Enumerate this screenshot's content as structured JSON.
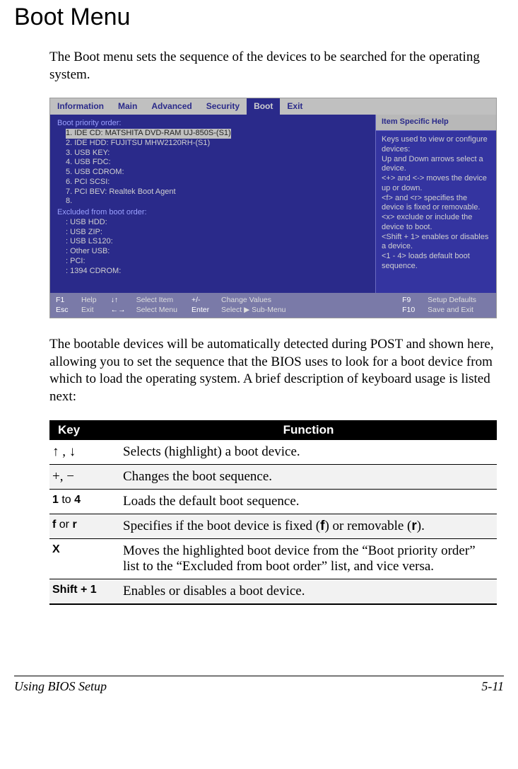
{
  "title": "Boot Menu",
  "intro": "The Boot menu sets the sequence of the devices to be searched for the operating system.",
  "bios": {
    "menu": [
      "Information",
      "Main",
      "Advanced",
      "Security",
      "Boot",
      "Exit"
    ],
    "selected_menu": "Boot",
    "left": {
      "header1": "Boot priority order:",
      "priority": [
        "1. IDE CD: MATSHITA DVD-RAM UJ-850S-(S1)",
        "2. IDE HDD: FUJITSU MHW2120RH-(S1)",
        "3. USB KEY:",
        "4. USB FDC:",
        "5. USB CDROM:",
        "6. PCI SCSI:",
        "7. PCI BEV: Realtek Boot Agent",
        "8."
      ],
      "header2": "Excluded from boot order:",
      "excluded": [
        ": USB HDD:",
        ": USB ZIP:",
        ": USB LS120:",
        ": Other USB:",
        ": PCI:",
        ": 1394 CDROM:"
      ]
    },
    "right": {
      "title": "Item Specific Help",
      "body": "Keys used to view or configure devices:\nUp and Down arrows select a device.\n<+> and <-> moves the device up or down.\n<f> and <r> specifies the device is fixed or removable.\n<x> exclude or include the device to boot.\n<Shift + 1> enables or disables a device.\n<1 - 4> loads default boot sequence."
    },
    "footer": {
      "c1k1": "F1",
      "c1v1": "Help",
      "c1k2": "Esc",
      "c1v2": "Exit",
      "c2k1": "↓↑",
      "c2v1": "Select Item",
      "c2k2": "←→",
      "c2v2": "Select Menu",
      "c3k1": "+/-",
      "c3v1": "Change Values",
      "c3k2": "Enter",
      "c3v2": "Select ▶ Sub-Menu",
      "c4k1": "F9",
      "c4v1": "Setup Defaults",
      "c4k2": "F10",
      "c4v2": "Save and Exit"
    }
  },
  "between": "The bootable devices will be automatically detected during POST and shown here, allowing you to set the sequence that the BIOS uses to look for a boot device from which to load the operating system. A brief description of keyboard usage is listed next:",
  "table": {
    "headers": {
      "key": "Key",
      "fn": "Function"
    },
    "rows": [
      {
        "key_html": "<span class='sym'>↑ , ↓</span>",
        "fn_html": "Selects (highlight) a boot device."
      },
      {
        "key_html": "<span class='sym'>+, −</span>",
        "fn_html": "Changes the boot sequence."
      },
      {
        "key_html": "<span class='b'>1</span> to <span class='b'>4</span>",
        "fn_html": "Loads the default boot sequence."
      },
      {
        "key_html": "<span class='b'>f</span> or <span class='b'>r</span>",
        "fn_html": "Specifies if the boot device is fixed (<span class='b' style='font-family:Arial'>f</span>) or removable (<span class='b' style='font-family:Arial'>r</span>)."
      },
      {
        "key_html": "<span class='b'>X</span>",
        "fn_html": "Moves the highlighted boot device from the “Boot priority order” list to the “Excluded from boot order” list, and vice versa."
      },
      {
        "key_html": "<span class='b'>Shift + 1</span>",
        "fn_html": "Enables or disables a boot device."
      }
    ]
  },
  "footer": {
    "left": "Using BIOS Setup",
    "right": "5-11"
  }
}
